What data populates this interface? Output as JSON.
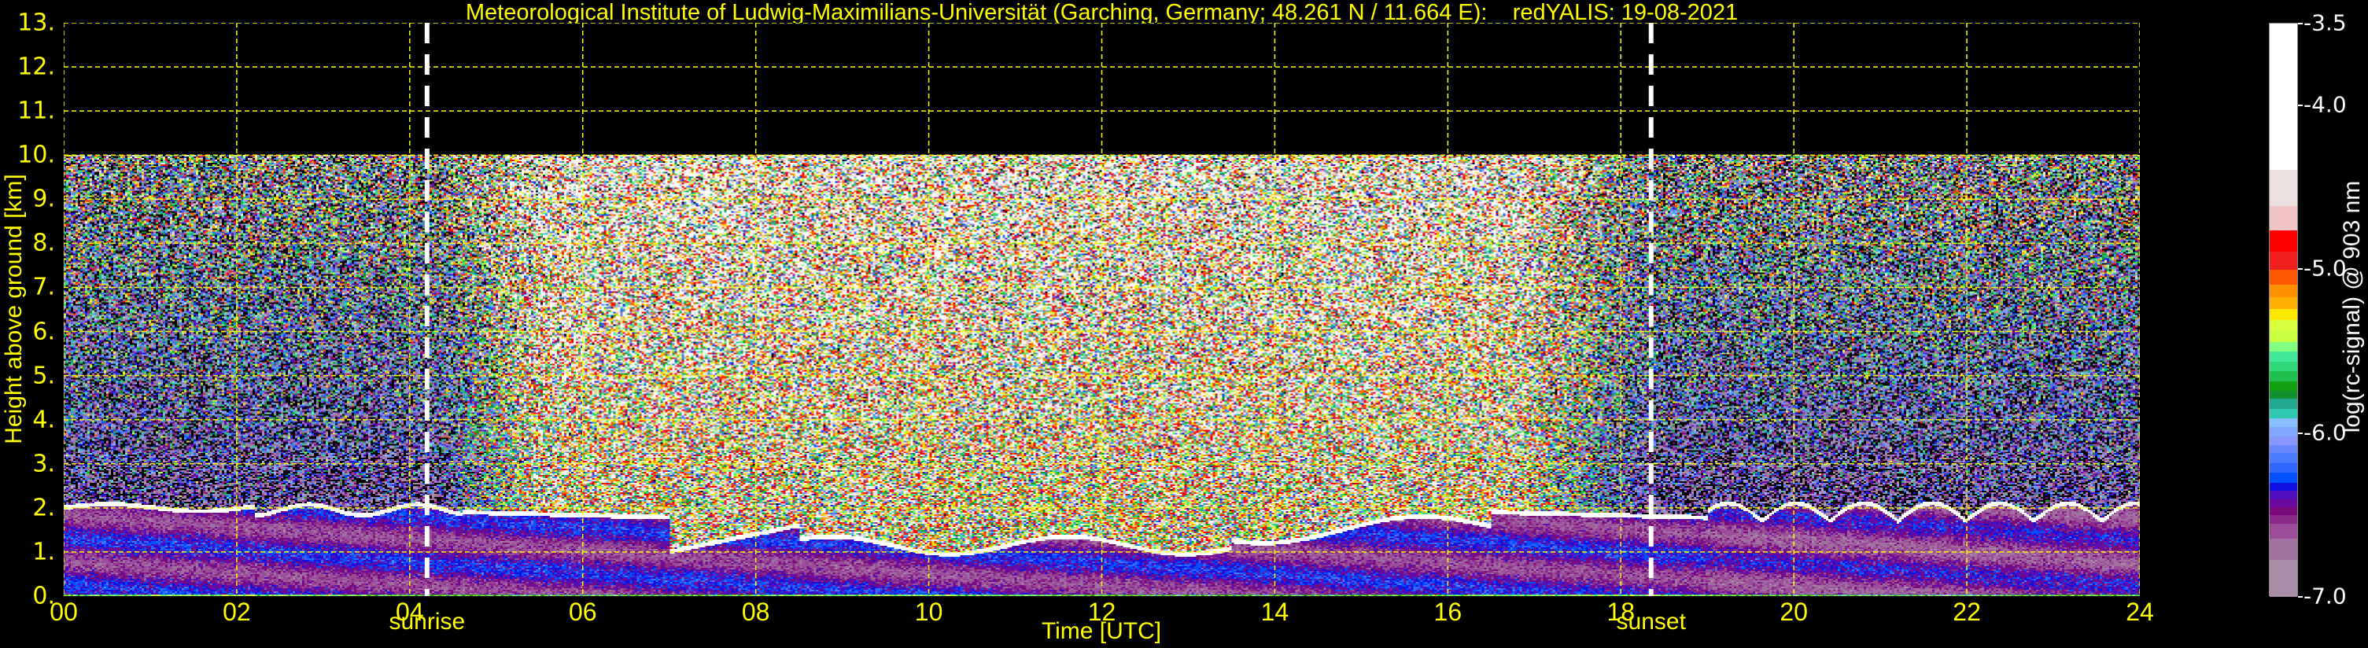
{
  "chart_data": {
    "type": "heatmap",
    "title": "Meteorological Institute of Ludwig-Maximilians-Universität (Garching, Germany; 48.261 N / 11.664 E):    redYALIS: 19-08-2021",
    "xlabel": "Time [UTC]",
    "ylabel": "Height above ground [km]",
    "xlim": [
      0,
      24
    ],
    "ylim": [
      0,
      13
    ],
    "x_ticks": [
      "00",
      "02",
      "04",
      "06",
      "08",
      "10",
      "12",
      "14",
      "16",
      "18",
      "20",
      "22",
      "24"
    ],
    "y_ticks": [
      "0.",
      "1.",
      "2.",
      "3.",
      "4.",
      "5.",
      "6.",
      "7.",
      "8.",
      "9.",
      "10.",
      "11.",
      "12.",
      "13."
    ],
    "grid": true,
    "data_top_km": 10,
    "annotations": [
      {
        "label": "sunrise",
        "x": 4.2
      },
      {
        "label": "sunset",
        "x": 18.35
      }
    ],
    "colorbar": {
      "label": "log(rc-signal) @ 903 nm",
      "range": [
        -7.0,
        -3.5
      ],
      "ticks": [
        "-3.5",
        "-4.0",
        "-5.0",
        "-6.0",
        "-7.0"
      ],
      "levels": [
        {
          "from": -7.0,
          "color": "#a88ca8"
        },
        {
          "from": -6.77,
          "color": "#a070a0"
        },
        {
          "from": -6.64,
          "color": "#9a4e9a"
        },
        {
          "from": -6.55,
          "color": "#8a2a88"
        },
        {
          "from": -6.5,
          "color": "#7a0a7a"
        },
        {
          "from": -6.45,
          "color": "#6a0aa0"
        },
        {
          "from": -6.4,
          "color": "#5010c0"
        },
        {
          "from": -6.35,
          "color": "#1010e0"
        },
        {
          "from": -6.3,
          "color": "#0050ff"
        },
        {
          "from": -6.24,
          "color": "#3068ff"
        },
        {
          "from": -6.18,
          "color": "#4a7aff"
        },
        {
          "from": -6.12,
          "color": "#6888ff"
        },
        {
          "from": -6.07,
          "color": "#8898ff"
        },
        {
          "from": -6.02,
          "color": "#80a8ff"
        },
        {
          "from": -5.96,
          "color": "#88c0ff"
        },
        {
          "from": -5.91,
          "color": "#30c8b0"
        },
        {
          "from": -5.85,
          "color": "#20a890"
        },
        {
          "from": -5.79,
          "color": "#129030"
        },
        {
          "from": -5.74,
          "color": "#10a010"
        },
        {
          "from": -5.68,
          "color": "#20c050"
        },
        {
          "from": -5.62,
          "color": "#30d878"
        },
        {
          "from": -5.56,
          "color": "#40e898"
        },
        {
          "from": -5.5,
          "color": "#80ff80"
        },
        {
          "from": -5.44,
          "color": "#c8ff40"
        },
        {
          "from": -5.37,
          "color": "#d8ff40"
        },
        {
          "from": -5.31,
          "color": "#ffe800"
        },
        {
          "from": -5.24,
          "color": "#ffb000"
        },
        {
          "from": -5.17,
          "color": "#ff9000"
        },
        {
          "from": -5.09,
          "color": "#ff5800"
        },
        {
          "from": -5.0,
          "color": "#f02020"
        },
        {
          "from": -4.89,
          "color": "#ff0000"
        },
        {
          "from": -4.76,
          "color": "#f0c4c4"
        },
        {
          "from": -4.61,
          "color": "#ece0e0"
        },
        {
          "from": -4.39,
          "color": "#ffffff"
        }
      ]
    }
  }
}
